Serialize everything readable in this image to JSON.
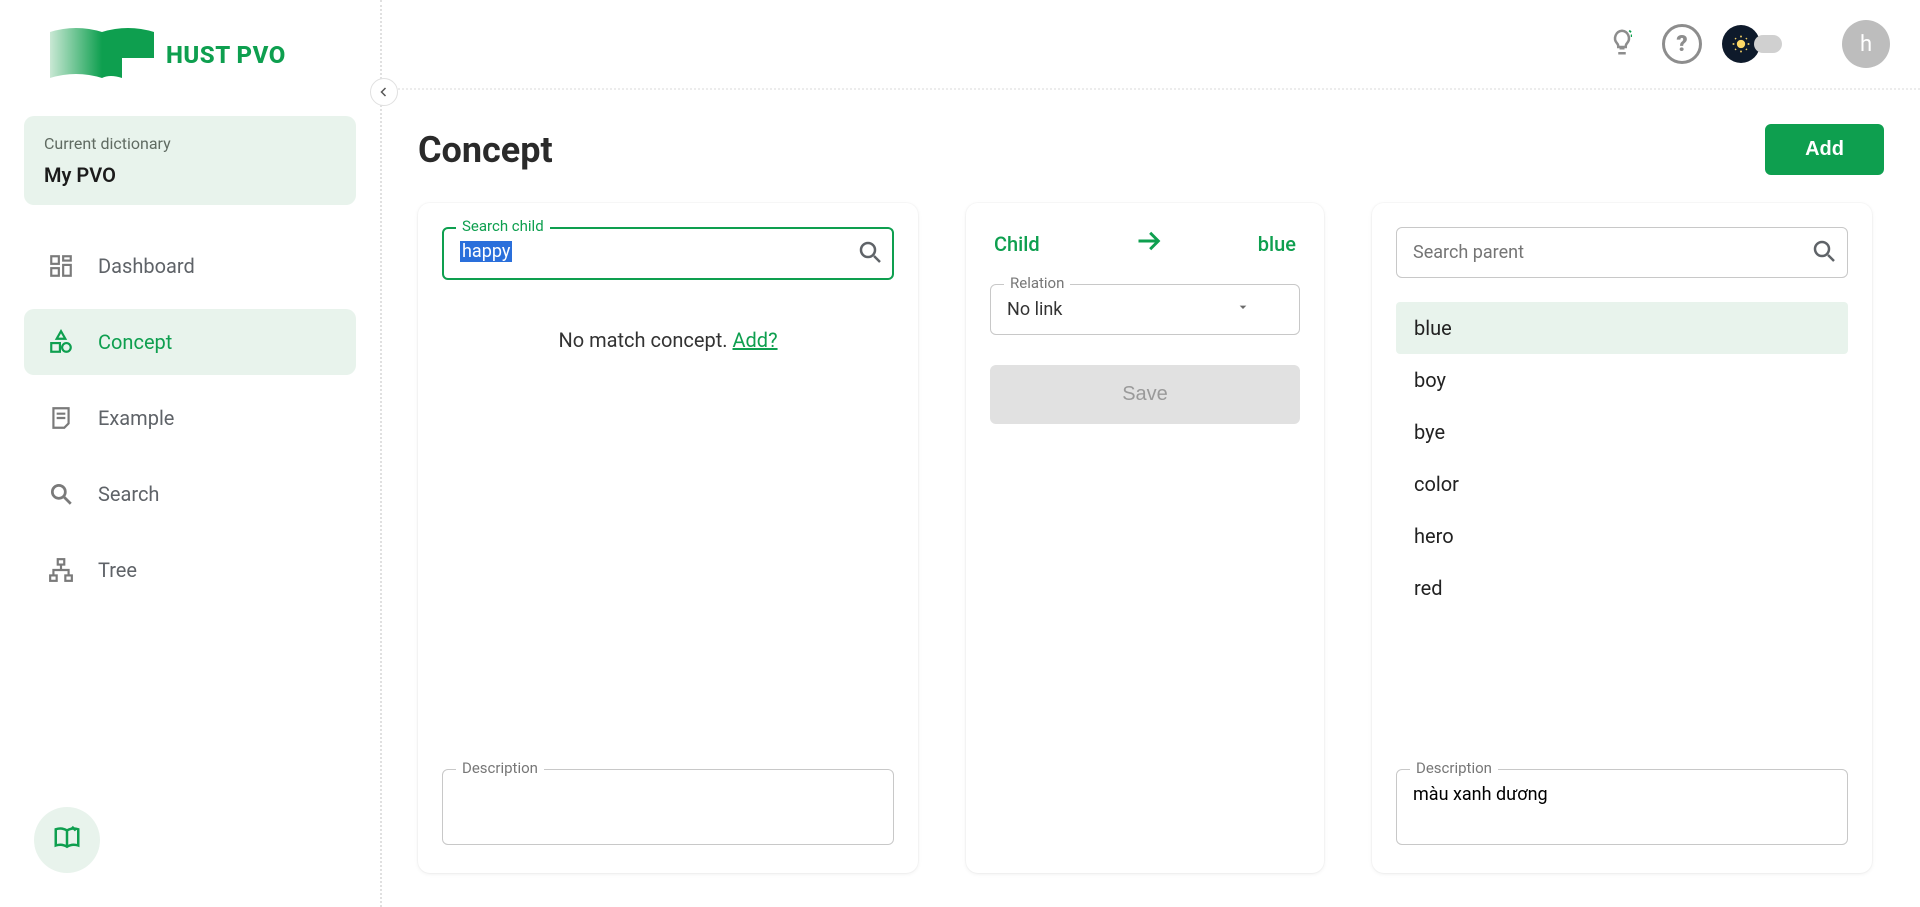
{
  "brand": {
    "name": "HUST PVO"
  },
  "sidebar": {
    "dict_label": "Current dictionary",
    "dict_name": "My PVO",
    "items": [
      {
        "key": "dashboard",
        "label": "Dashboard"
      },
      {
        "key": "concept",
        "label": "Concept"
      },
      {
        "key": "example",
        "label": "Example"
      },
      {
        "key": "search",
        "label": "Search"
      },
      {
        "key": "tree",
        "label": "Tree"
      }
    ],
    "active_index": 1
  },
  "topbar": {
    "avatar_initial": "h"
  },
  "page": {
    "title": "Concept",
    "add_button": "Add"
  },
  "child_panel": {
    "search_label": "Search child",
    "search_value": "happy",
    "no_match_prefix": "No match concept. ",
    "no_match_link": "Add?",
    "description_label": "Description",
    "description_value": ""
  },
  "middle_panel": {
    "left_label": "Child",
    "right_label": "blue",
    "relation_label": "Relation",
    "relation_value": "No link",
    "save_label": "Save"
  },
  "parent_panel": {
    "search_placeholder": "Search parent",
    "results": [
      "blue",
      "boy",
      "bye",
      "color",
      "hero",
      "red"
    ],
    "selected_index": 0,
    "description_label": "Description",
    "description_value": "màu xanh dương"
  }
}
